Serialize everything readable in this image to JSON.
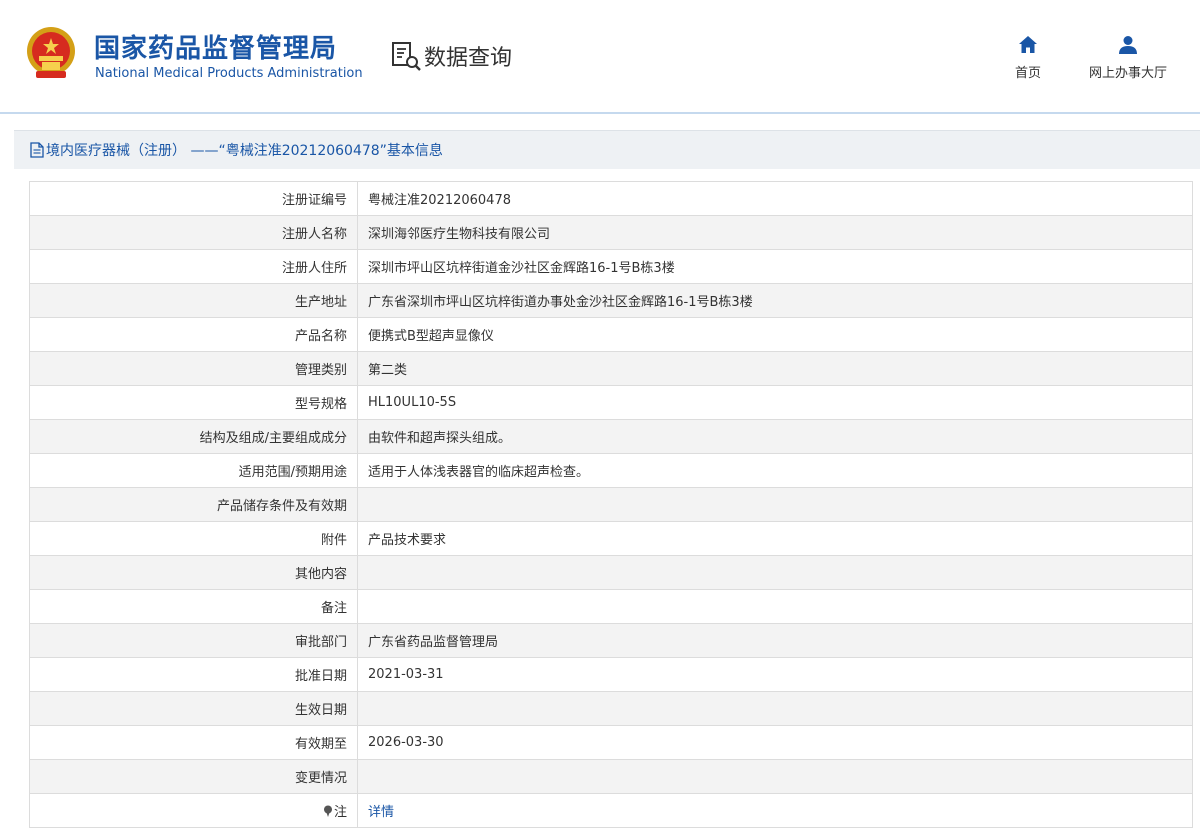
{
  "header": {
    "org_name_cn": "国家药品监督管理局",
    "org_name_en": "National Medical Products Administration",
    "query_title": "数据查询",
    "nav": [
      {
        "label": "首页",
        "icon": "home-icon"
      },
      {
        "label": "网上办事大厅",
        "icon": "user-icon"
      }
    ]
  },
  "section": {
    "title": "境内医疗器械（注册） ——“粤械注准20212060478”基本信息"
  },
  "colors": {
    "brand_blue": "#1a56a6",
    "row_alt": "#f3f3f3",
    "section_bg": "#eef1f4"
  },
  "table": {
    "rows": [
      {
        "label": "注册证编号",
        "value": "粤械注准20212060478"
      },
      {
        "label": "注册人名称",
        "value": "深圳海邻医疗生物科技有限公司"
      },
      {
        "label": "注册人住所",
        "value": "深圳市坪山区坑梓街道金沙社区金辉路16-1号B栋3楼"
      },
      {
        "label": "生产地址",
        "value": "广东省深圳市坪山区坑梓街道办事处金沙社区金辉路16-1号B栋3楼"
      },
      {
        "label": "产品名称",
        "value": "便携式B型超声显像仪"
      },
      {
        "label": "管理类别",
        "value": "第二类"
      },
      {
        "label": "型号规格",
        "value": "HL10UL10-5S"
      },
      {
        "label": "结构及组成/主要组成成分",
        "value": "由软件和超声探头组成。"
      },
      {
        "label": "适用范围/预期用途",
        "value": "适用于人体浅表器官的临床超声检查。"
      },
      {
        "label": "产品储存条件及有效期",
        "value": ""
      },
      {
        "label": "附件",
        "value": "产品技术要求"
      },
      {
        "label": "其他内容",
        "value": ""
      },
      {
        "label": "备注",
        "value": ""
      },
      {
        "label": "审批部门",
        "value": "广东省药品监督管理局"
      },
      {
        "label": "批准日期",
        "value": "2021-03-31"
      },
      {
        "label": "生效日期",
        "value": ""
      },
      {
        "label": "有效期至",
        "value": "2026-03-30"
      },
      {
        "label": "变更情况",
        "value": ""
      }
    ],
    "note_row": {
      "label": "注",
      "link": "详情",
      "icon": "pin-icon"
    }
  }
}
